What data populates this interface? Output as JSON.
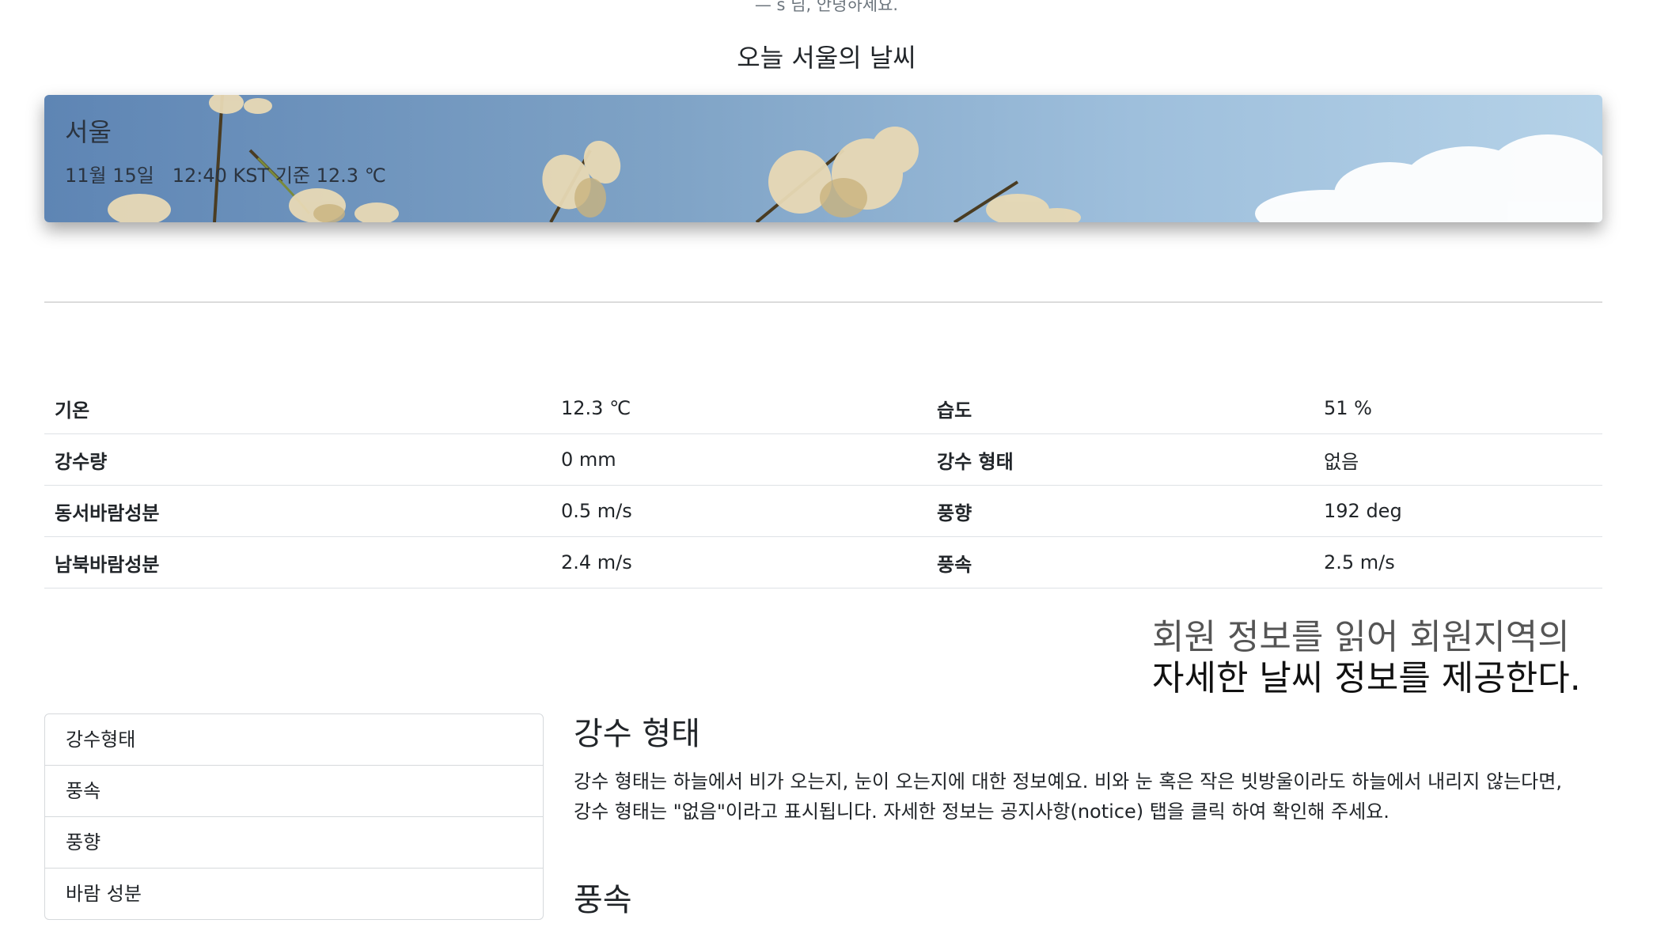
{
  "greeting": "— s 님, 안녕하세요.",
  "page_title": "오늘 서울의 날씨",
  "banner": {
    "city": "서울",
    "date": "11월 15일",
    "time": "12:40 KST 기준",
    "temp": "12.3 ℃"
  },
  "stats": [
    {
      "label1": "기온",
      "value1": "12.3 ℃",
      "label2": "습도",
      "value2": "51 %"
    },
    {
      "label1": "강수량",
      "value1": "0 mm",
      "label2": "강수 형태",
      "value2": "없음"
    },
    {
      "label1": "동서바람성분",
      "value1": "0.5 m/s",
      "label2": "풍향",
      "value2": "192 deg"
    },
    {
      "label1": "남북바람성분",
      "value1": "2.4 m/s",
      "label2": "풍속",
      "value2": "2.5 m/s"
    }
  ],
  "note": {
    "line1": "회원 정보를 읽어 회원지역의",
    "line2": "자세한 날씨 정보를 제공한다."
  },
  "menu": [
    "강수형태",
    "풍속",
    "풍향",
    "바람 성분"
  ],
  "content": {
    "heading1": "강수 형태",
    "para1": "강수 형태는 하늘에서 비가 오는지, 눈이 오는지에 대한 정보예요. 비와 눈 혹은 작은 빗방울이라도 하늘에서 내리지 않는다면,",
    "para2": "강수 형태는 \"없음\"이라고 표시됩니다. 자세한 정보는 공지사항(notice) 탭을 클릭 하여 확인해 주세요.",
    "heading2": "풍속"
  }
}
